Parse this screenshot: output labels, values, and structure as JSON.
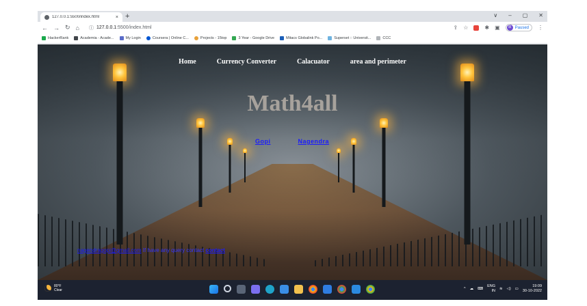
{
  "browser": {
    "tab_title": "127.0.0.1:5500/index.html",
    "tab_close": "×",
    "new_tab": "+",
    "window_controls": [
      "∨",
      "–",
      "▢",
      "✕"
    ],
    "url_host": "127.0.0.1",
    "url_rest": ":5500/index.html",
    "paused_label": "Paused",
    "profile_initial": "B",
    "bookmarks": [
      "HackerRank",
      "Academia - Acade...",
      "My Login",
      "Coursera | Online C...",
      "Projects - 15top",
      "3 Year - Google Drive",
      "Mitacs Globalink Po...",
      "Superset :: Universit...",
      "CCC"
    ]
  },
  "site": {
    "nav": [
      "Home",
      "Currency Converter",
      "Calacuator",
      "area and perimeter"
    ],
    "hero_title": "Math4all",
    "authors": [
      "Gopi",
      "Nagendra"
    ],
    "contact_email": "nagendragopi@gmail.com",
    "contact_text": "If have any query contact",
    "contact_link": "contact"
  },
  "taskbar": {
    "weather_temp": "80°F",
    "weather_cond": "Clear",
    "language": "ENG",
    "region": "IN",
    "time": "19:09",
    "date": "30-10-2022"
  },
  "colors": {
    "taskbar": "#1c2230",
    "link": "#1a1aff",
    "hero": "#a7a29c"
  }
}
